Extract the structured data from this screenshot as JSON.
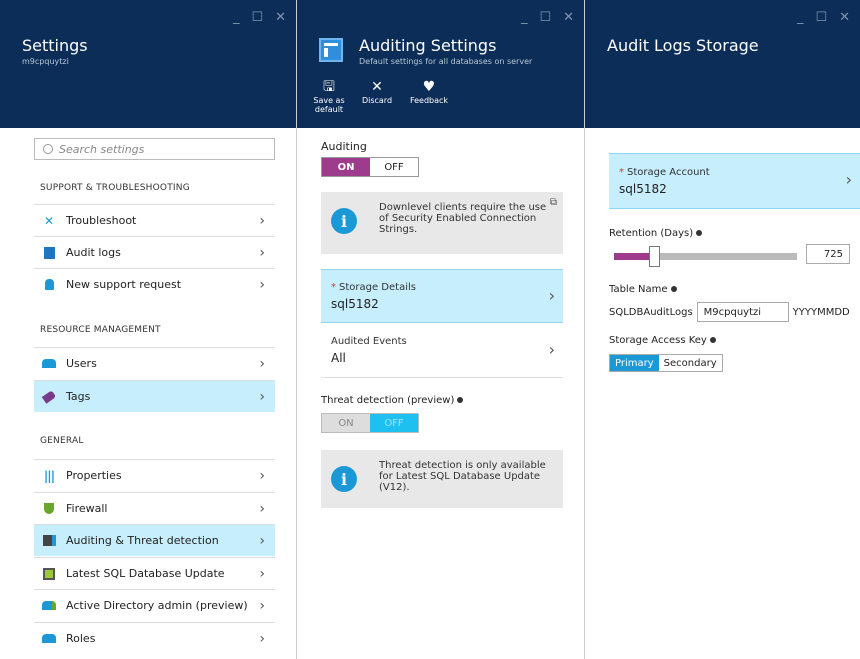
{
  "blade1": {
    "title": "Settings",
    "subtitle": "m9cpquytzi",
    "search_placeholder": "Search settings",
    "sections": {
      "support": "SUPPORT & TROUBLESHOOTING",
      "resource": "RESOURCE MANAGEMENT",
      "general": "GENERAL"
    },
    "support_items": [
      {
        "label": "Troubleshoot",
        "icon": "wrench-icon"
      },
      {
        "label": "Audit logs",
        "icon": "log-icon"
      },
      {
        "label": "New support request",
        "icon": "person-icon"
      }
    ],
    "resource_items": [
      {
        "label": "Users",
        "icon": "users-icon"
      },
      {
        "label": "Tags",
        "icon": "tag-icon"
      }
    ],
    "general_items": [
      {
        "label": "Properties",
        "icon": "properties-icon"
      },
      {
        "label": "Firewall",
        "icon": "firewall-icon"
      },
      {
        "label": "Auditing & Threat detection",
        "icon": "auditing-icon"
      },
      {
        "label": "Latest SQL Database Update",
        "icon": "update-icon"
      },
      {
        "label": "Active Directory admin (preview)",
        "icon": "ad-admin-icon"
      },
      {
        "label": "Roles",
        "icon": "roles-icon"
      }
    ]
  },
  "blade2": {
    "title": "Auditing Settings",
    "subtitle": "Default settings for all databases on server",
    "toolbar": {
      "save_label": "Save as default",
      "discard_label": "Discard",
      "feedback_label": "Feedback"
    },
    "auditing_label": "Auditing",
    "on_label": "ON",
    "off_label": "OFF",
    "info1": "Downlevel clients require the use of Security Enabled Connection Strings.",
    "storage_details_label": "Storage Details",
    "storage_details_value": "sql5182",
    "audited_events_label": "Audited Events",
    "audited_events_value": "All",
    "threat_label": "Threat detection (preview)",
    "threat_on": "ON",
    "threat_off": "OFF",
    "info2": "Threat detection is only available for Latest SQL Database Update (V12)."
  },
  "blade3": {
    "title": "Audit Logs Storage",
    "storage_account_label": "Storage Account",
    "storage_account_value": "sql5182",
    "retention_label": "Retention (Days)",
    "retention_value": "725",
    "retention_fraction": 0.22,
    "table_name_label": "Table Name",
    "table_prefix": "SQLDBAuditLogs",
    "table_input": "M9cpquytzi",
    "table_suffix": "YYYYMMDD",
    "access_key_label": "Storage Access Key",
    "key_primary": "Primary",
    "key_secondary": "Secondary"
  },
  "colors": {
    "header": "#0b2d57",
    "selected": "#c6eefc",
    "toggle_on": "#9e3b8c",
    "accent": "#1b99d6"
  }
}
